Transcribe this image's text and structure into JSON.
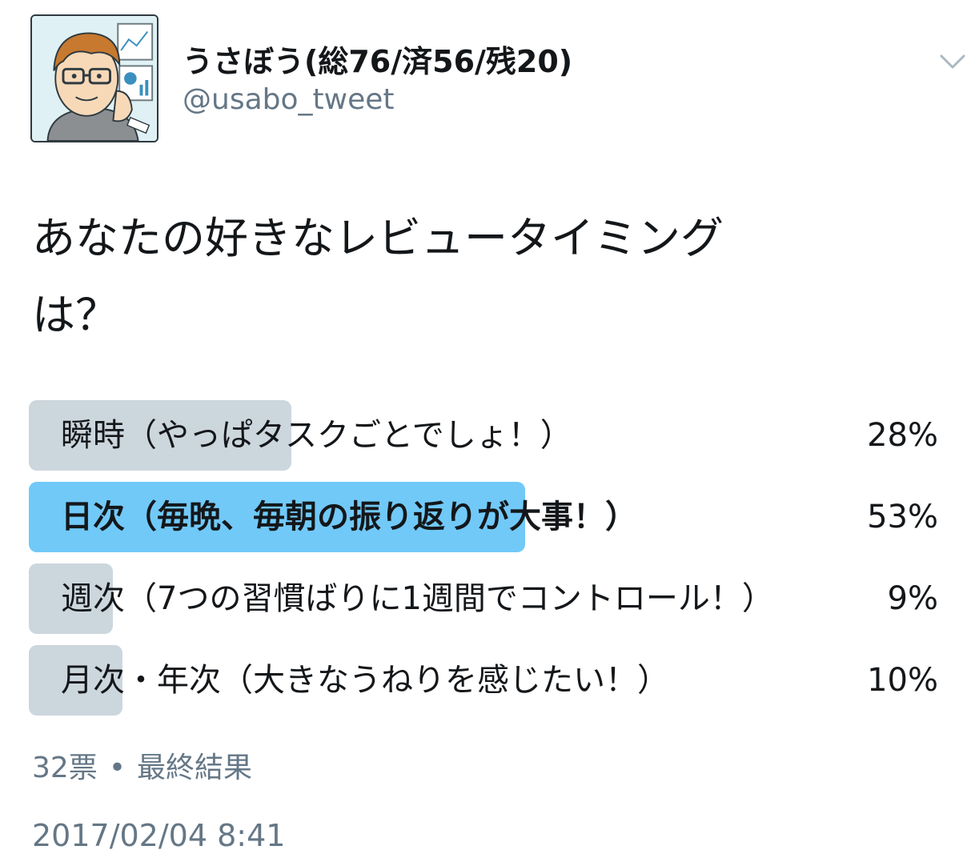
{
  "tweet": {
    "display_name": "うさぼう(総76/済56/残20)",
    "handle": "@usabo_tweet",
    "question_line1": "あなたの好きなレビュータイミング",
    "question_line2": "は？"
  },
  "poll": {
    "options": [
      {
        "label": "瞬時（やっぱタスクごとでしょ！）",
        "percent_text": "28%",
        "fraction": 0.28,
        "winner": false
      },
      {
        "label": "日次（毎晩、毎朝の振り返りが大事！）",
        "percent_text": "53%",
        "fraction": 0.53,
        "winner": true
      },
      {
        "label": "週次（7つの習慣ばりに1週間でコントロール！）",
        "percent_text": "9%",
        "fraction": 0.09,
        "winner": false
      },
      {
        "label": "月次・年次（大きなうねりを感じたい！）",
        "percent_text": "10%",
        "fraction": 0.1,
        "winner": false
      }
    ],
    "votes": "32票",
    "separator": "•",
    "status": "最終結果"
  },
  "timestamp": "2017/02/04 8:41",
  "colors": {
    "winner_bar": "#71c9f8",
    "bar": "#ccd6dd",
    "secondary_text": "#657786"
  },
  "icons": {
    "avatar": "illustrated-avatar",
    "menu": "chevron-down-icon"
  }
}
